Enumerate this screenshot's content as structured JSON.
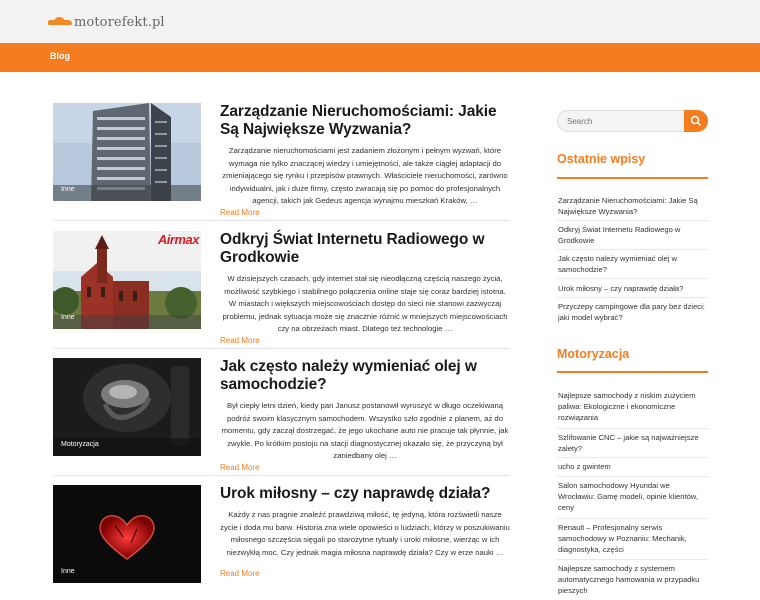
{
  "site": {
    "logo_text": "motorefekt.pl"
  },
  "nav": {
    "blog_label": "Blog"
  },
  "posts": [
    {
      "title": "Zarządzanie Nieruchomościami: Jakie Są Największe Wyzwania?",
      "excerpt": "Zarządzanie nieruchomościami jest zadaniem złożonym i pełnym wyzwań, które wymaga nie tylko znaczącej wiedzy i umiejętności, ale także ciągłej adaptacji do zmieniającego się rynku i przepisów prawnych. Właściciele nieruchomości, zarówno indywidualni, jak i duże firmy, często zwracają się po pomoc do profesjonalnych agencji, takich jak Gedeus agencja wynajmu mieszkań Kraków, …",
      "category": "Inne",
      "read_more": "Read More"
    },
    {
      "title": "Odkryj Świat Internetu Radiowego w Grodkowie",
      "excerpt": "W dzisiejszych czasach, gdy internet stał się nieodłączną częścią naszego życia, możliwość szybkiego i stabilnego połączenia online staje się coraz bardziej istotna. W miastach i większych miejscowościach dostęp do sieci nie stanowi zazwyczaj problemu, jednak sytuacja może się znacznie różnić w mniejszych miejscowościach czy na obrzeżach miast. Dlatego też technologie …",
      "category": "Inne",
      "thumb_brand": "Airmax",
      "read_more": "Read More"
    },
    {
      "title": "Jak często należy wymieniać olej w samochodzie?",
      "excerpt": "Był ciepły letni dzień, kiedy pan Janusz postanowił wyruszyć w długo oczekiwaną podróż swoim klasycznym samochodem. Wszystko szło zgodnie z planem, aż do momentu, gdy zaczął dostrzegać, że jego ukochane auto nie pracuje tak płynnie, jak zwykle. Po krótkim postoju na stacji diagnostycznej okazało się, że przyczyną był zaniedbany olej …",
      "category": "Motoryzacja",
      "read_more": "Read More"
    },
    {
      "title": "Urok miłosny – czy naprawdę działa?",
      "excerpt": "Każdy z nas pragnie znaleźć prawdziwą miłość, tę jedyną, która rozświetli nasze życie i doda mu barw. Historia zna wiele opowieści o ludziach, którzy w poszukiwaniu miłosnego szczęścia sięgali po starożytne rytuały i uroki miłosne, wierząc w ich niezwykłą moc. Czy jednak magia miłosna naprawdę działa? Czy w erze nauki …",
      "category": "Inne",
      "read_more": "Read More"
    }
  ],
  "sidebar": {
    "search_placeholder": "Search",
    "recent_title": "Ostatnie wpisy",
    "recent": [
      "Zarządzanie Nieruchomościami: Jakie Są Największe Wyzwania?",
      "Odkryj Świat Internetu Radiowego w Grodkowie",
      "Jak często należy wymieniać olej w samochodzie?",
      "Urok miłosny – czy naprawdę działa?",
      "Przyczepy campingowe dla pary bez dzieci: jaki model wybrać?"
    ],
    "moto_title": "Motoryzacja",
    "moto": [
      "Najlepsze samochody z niskim zużyciem paliwa: Ekologiczne i ekonomiczne rozwiązania",
      "Szlifowanie CNC – jakie są najważniejsze zalety?",
      "ucho z gwintem",
      "Salon samochodowy Hyundai we Wrocławiu: Gamę modeli, opinie klientów, ceny",
      "Renault – Profesjonalny serwis samochodowy w Poznaniu: Mechanik, diagnostyka, części",
      "Najlepsze samochody z systemem automatycznego hamowania w przypadku pieszych"
    ]
  },
  "colors": {
    "accent": "#f57c1f",
    "topbar": "#f2f2f2"
  }
}
